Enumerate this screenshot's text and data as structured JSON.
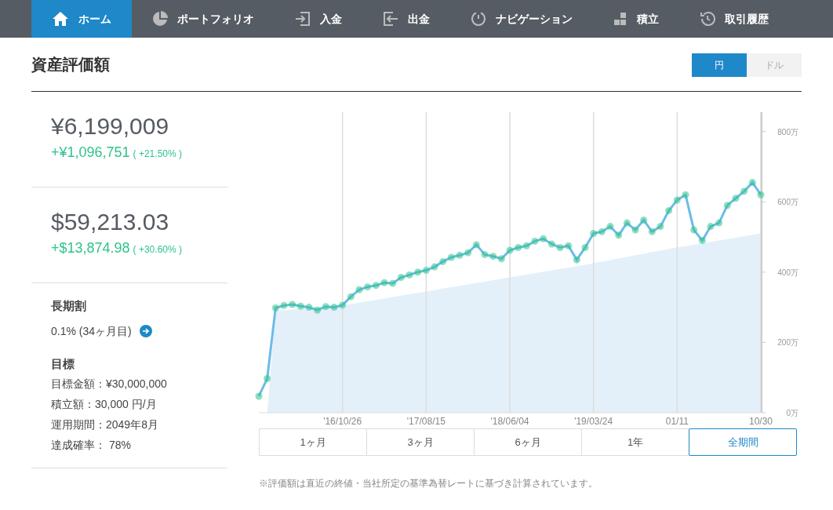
{
  "nav": [
    {
      "label": "ホーム",
      "selected": true
    },
    {
      "label": "ポートフォリオ",
      "selected": false
    },
    {
      "label": "入金",
      "selected": false
    },
    {
      "label": "出金",
      "selected": false
    },
    {
      "label": "ナビゲーション",
      "selected": false
    },
    {
      "label": "積立",
      "selected": false
    },
    {
      "label": "取引履歴",
      "selected": false
    }
  ],
  "title": "資産評価額",
  "currency_toggle": [
    {
      "label": "円",
      "selected": true
    },
    {
      "label": "ドル",
      "selected": false
    }
  ],
  "summaries": [
    {
      "value": "¥6,199,009",
      "change": "+¥1,096,751",
      "percent": "( +21.50% )"
    },
    {
      "value": "$59,213.03",
      "change": "+$13,874.98",
      "percent": "( +30.60% )"
    }
  ],
  "long_term": {
    "heading": "長期割",
    "text": "0.1% (34ヶ月目)"
  },
  "goal": {
    "heading": "目標",
    "lines": [
      "目標金額：¥30,000,000",
      "積立額：30,000 円/月",
      "運用期間：2049年8月",
      "達成確率： 78%"
    ]
  },
  "chart": {
    "chart_data": {
      "type": "line",
      "categories": [
        null,
        null,
        null,
        null,
        null,
        null,
        null,
        null,
        null,
        null,
        "'16/10/26",
        null,
        null,
        null,
        null,
        null,
        null,
        null,
        null,
        null,
        "'17/08/15",
        null,
        null,
        null,
        null,
        null,
        null,
        null,
        null,
        null,
        "'18/06/04",
        null,
        null,
        null,
        null,
        null,
        null,
        null,
        null,
        null,
        "'19/03/24",
        null,
        null,
        null,
        null,
        null,
        null,
        null,
        null,
        null,
        "01/11",
        null,
        null,
        null,
        null,
        null,
        null,
        null,
        null,
        null,
        "10/30"
      ],
      "series": [
        {
          "type": "line",
          "color": "#6cbbe8",
          "marker": "circle",
          "values": [
            47,
            97,
            298,
            305,
            308,
            303,
            300,
            292,
            302,
            300,
            306,
            330,
            350,
            358,
            362,
            370,
            368,
            385,
            392,
            400,
            405,
            415,
            430,
            442,
            448,
            455,
            478,
            450,
            445,
            438,
            462,
            470,
            475,
            488,
            495,
            480,
            470,
            475,
            435,
            470,
            510,
            515,
            530,
            505,
            540,
            520,
            548,
            515,
            530,
            575,
            605,
            620,
            520,
            490,
            530,
            540,
            590,
            610,
            630,
            655,
            620
          ]
        },
        {
          "type": "area",
          "color": "#e3f0f9",
          "values": [
            0,
            0,
            290,
            292,
            294,
            296,
            298,
            300,
            302,
            304,
            305,
            309,
            313,
            317,
            321,
            325,
            329,
            333,
            337,
            341,
            345,
            349,
            353,
            357,
            361,
            365,
            369,
            373,
            377,
            381,
            385,
            389,
            393,
            397,
            401,
            405,
            409,
            413,
            417,
            421,
            425,
            430,
            434,
            439,
            443,
            448,
            452,
            457,
            461,
            466,
            470,
            474,
            478,
            482,
            486,
            490,
            494,
            498,
            502,
            506,
            510
          ]
        }
      ],
      "ylim": [
        0,
        855
      ],
      "grid": true,
      "yticks": [
        {
          "value": 0,
          "label": "0万"
        },
        {
          "value": 200,
          "label": "200万"
        },
        {
          "value": 400,
          "label": "400万"
        },
        {
          "value": 600,
          "label": "600万"
        },
        {
          "value": 800,
          "label": "800万"
        }
      ]
    }
  },
  "periods": [
    {
      "label": "1ヶ月",
      "selected": false
    },
    {
      "label": "3ヶ月",
      "selected": false
    },
    {
      "label": "6ヶ月",
      "selected": false
    },
    {
      "label": "1年",
      "selected": false
    },
    {
      "label": "全期間",
      "selected": true
    }
  ],
  "note": "※評価額は直近の終値・当社所定の基準為替レートに基づき計算されています。"
}
